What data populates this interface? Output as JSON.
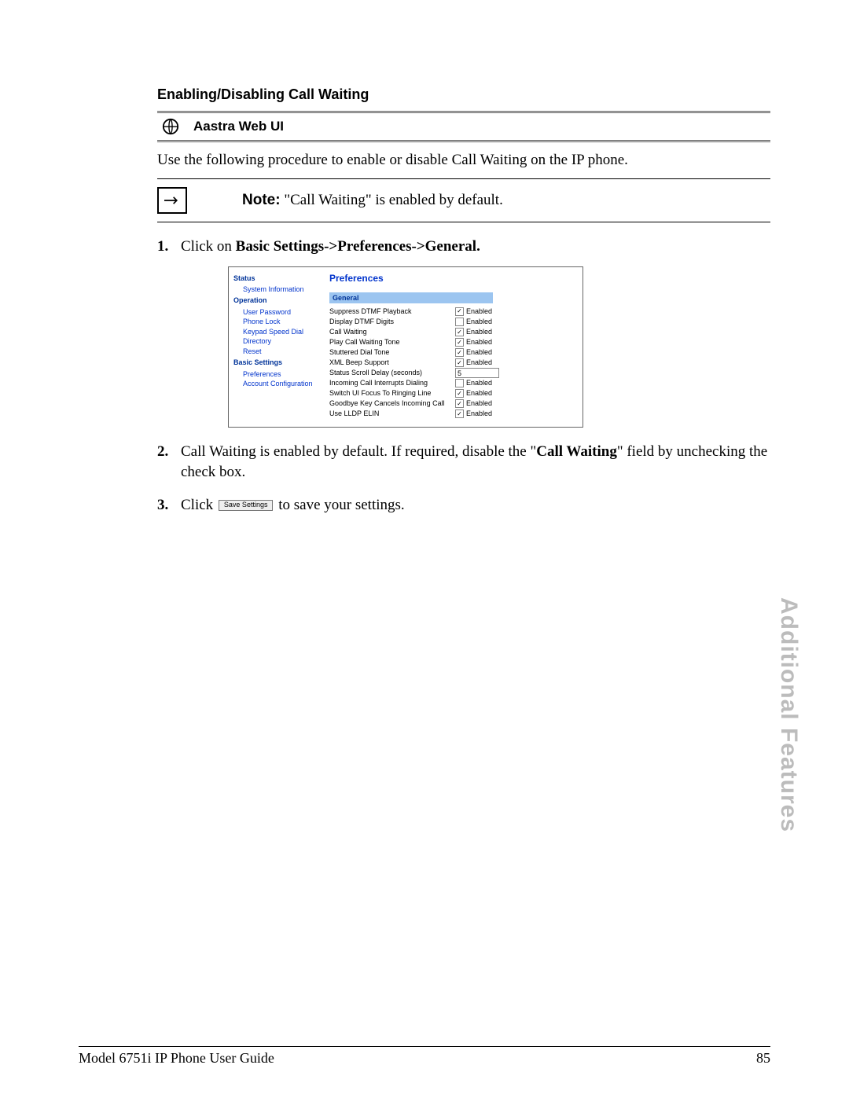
{
  "heading": "Enabling/Disabling Call Waiting",
  "webui_label": "Aastra Web UI",
  "intro": "Use the following procedure to enable or disable Call Waiting on the IP phone.",
  "note_prefix": "Note:",
  "note_body": " \"Call Waiting\" is enabled by default.",
  "steps": {
    "s1_a": "Click on ",
    "s1_b": "Basic Settings->Preferences->General.",
    "s2_a": "Call Waiting is enabled by default. If required, disable the \"",
    "s2_b": "Call Waiting",
    "s2_c": "\" field by unchecking the check box.",
    "s3_a": "Click ",
    "s3_btn": "Save Settings",
    "s3_b": " to save your settings."
  },
  "ui": {
    "sidebar": {
      "cat1": "Status",
      "i1": "System Information",
      "cat2": "Operation",
      "i2": "User Password",
      "i3": "Phone Lock",
      "i4": "Keypad Speed Dial",
      "i5": "Directory",
      "i6": "Reset",
      "cat3": "Basic Settings",
      "i7": "Preferences",
      "i8": "Account Configuration"
    },
    "title": "Preferences",
    "general": "General",
    "rows": {
      "r1": "Suppress DTMF Playback",
      "r2": "Display DTMF Digits",
      "r3": "Call Waiting",
      "r4": "Play Call Waiting Tone",
      "r5": "Stuttered Dial Tone",
      "r6": "XML Beep Support",
      "r7": "Status Scroll Delay (seconds)",
      "r8": "Incoming Call Interrupts Dialing",
      "r9": "Switch UI Focus To Ringing Line",
      "r10": "Goodbye Key Cancels Incoming Call",
      "r11": "Use LLDP ELIN"
    },
    "enabled": "Enabled",
    "scroll_value": "5"
  },
  "side_tab": "Additional Features",
  "footer_left": "Model 6751i IP Phone User Guide",
  "footer_right": "85"
}
